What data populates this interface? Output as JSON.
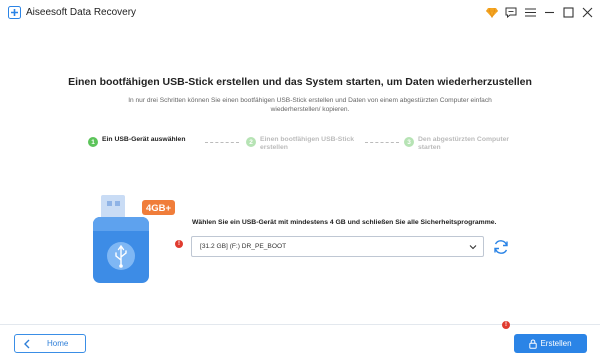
{
  "app": {
    "title": "Aiseesoft Data Recovery"
  },
  "titlebar": {
    "icons": [
      "diamond-icon",
      "feedback-icon",
      "menu-icon",
      "minimize-icon",
      "maximize-icon",
      "close-icon"
    ]
  },
  "main": {
    "heading": "Einen bootfähigen USB-Stick erstellen und das System starten, um Daten wiederherzustellen",
    "subheading": "In nur drei Schritten können Sie einen bootfähigen USB-Stick erstellen und Daten von einem abgestürzten Computer einfach wiederherstellen/ kopieren."
  },
  "steps": [
    {
      "number": "1",
      "label": "Ein USB-Gerät auswählen",
      "active": true
    },
    {
      "number": "2",
      "label": "Einen bootfähigen USB-Stick erstellen",
      "active": false
    },
    {
      "number": "3",
      "label": "Den abgestürzten Computer starten",
      "active": false
    }
  ],
  "usb": {
    "badge": "4GB+"
  },
  "device": {
    "instruction": "Wählen Sie ein USB-Gerät mit mindestens 4 GB und schließen Sie alle Sicherheitsprogramme.",
    "selected": "[31.2 GB] (F:) DR_PE_BOOT",
    "error_marker": "!"
  },
  "footer": {
    "home_label": "Home",
    "create_label": "Erstellen",
    "create_marker": "!"
  },
  "colors": {
    "accent": "#2b84e6",
    "step_active": "#5cc45a",
    "error": "#e03b2f",
    "badge": "#f07d3a"
  }
}
